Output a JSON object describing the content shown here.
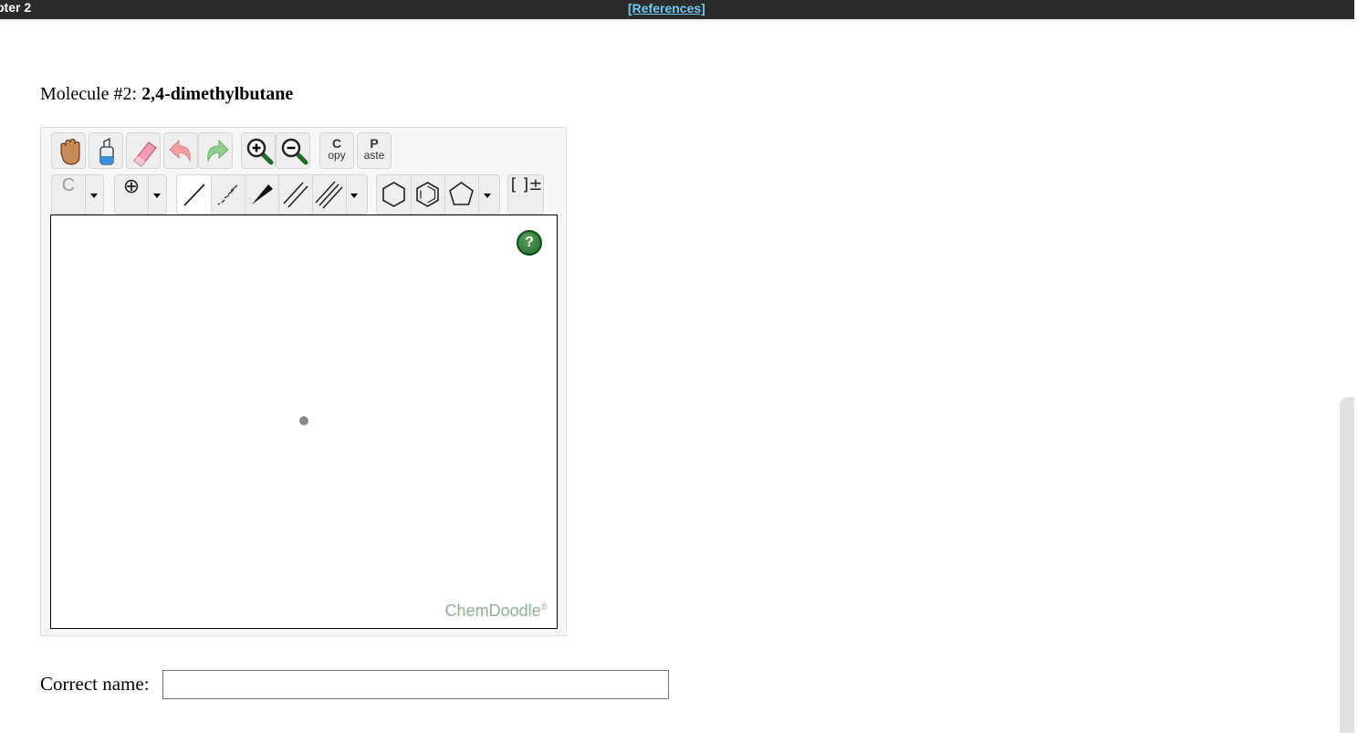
{
  "header": {
    "chapter_label": "pter 2",
    "references_link": "[References]"
  },
  "question": {
    "prefix": "Molecule #2: ",
    "molecule_name": "2,4-dimethylbutane"
  },
  "toolbar": {
    "row1": [
      {
        "name": "hand-pan-icon"
      },
      {
        "name": "clear-canvas-icon"
      },
      {
        "name": "eraser-icon"
      },
      {
        "name": "undo-icon"
      },
      {
        "name": "redo-icon"
      },
      {
        "name": "zoom-in-icon"
      },
      {
        "name": "zoom-out-icon"
      },
      {
        "name": "copy-button",
        "big": "C",
        "small": "opy"
      },
      {
        "name": "paste-button",
        "big": "P",
        "small": "aste"
      }
    ],
    "atom_label": "C",
    "charge_symbol": "⊕",
    "bracket_symbol": "[ ]±",
    "selected_tool": "single-bond"
  },
  "canvas": {
    "help_label": "?",
    "brand": "ChemDoodle",
    "brand_mark": "®"
  },
  "answer": {
    "label": "Correct name:",
    "value": ""
  },
  "colors": {
    "topbar": "#2b2b2b",
    "reference_link": "#6fc8f0",
    "brand": "#8fb08f",
    "help": "#2e7d32"
  }
}
